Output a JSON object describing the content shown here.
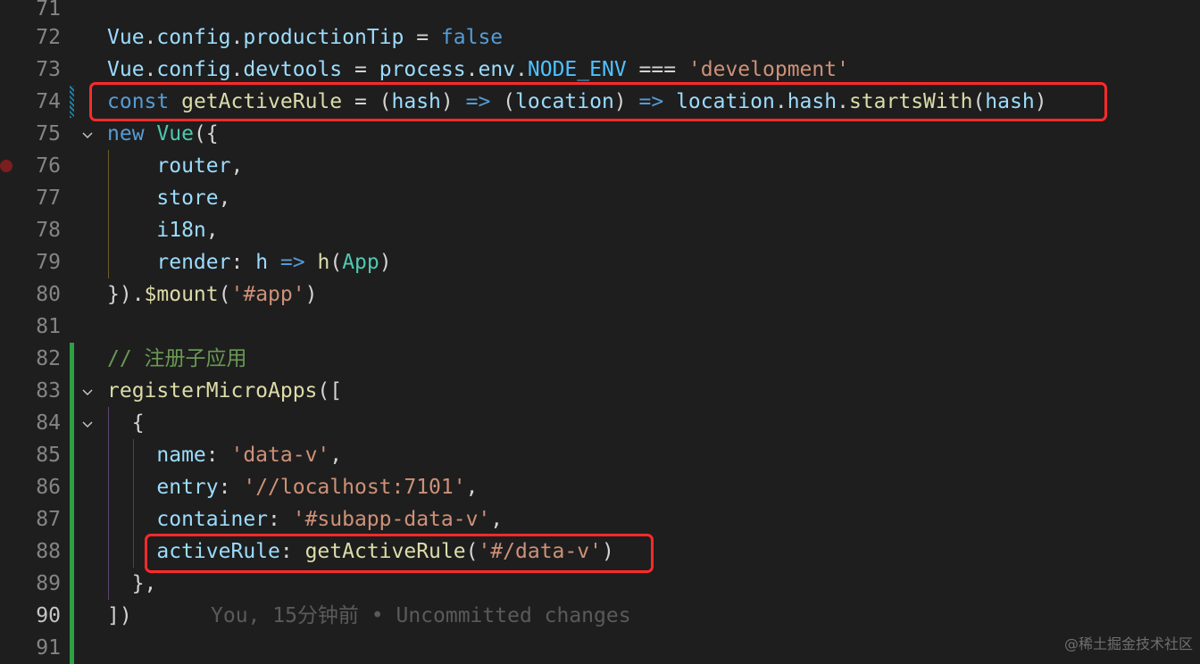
{
  "editor": {
    "lines": [
      {
        "n": "71"
      },
      {
        "n": "72",
        "tokens": [
          [
            "var",
            "Vue"
          ],
          [
            "pun",
            "."
          ],
          [
            "var",
            "config"
          ],
          [
            "pun",
            "."
          ],
          [
            "var",
            "productionTip"
          ],
          [
            "op",
            " = "
          ],
          [
            "kw",
            "false"
          ]
        ]
      },
      {
        "n": "73",
        "tokens": [
          [
            "var",
            "Vue"
          ],
          [
            "pun",
            "."
          ],
          [
            "var",
            "config"
          ],
          [
            "pun",
            "."
          ],
          [
            "var",
            "devtools"
          ],
          [
            "op",
            " = "
          ],
          [
            "var",
            "process"
          ],
          [
            "pun",
            "."
          ],
          [
            "var",
            "env"
          ],
          [
            "pun",
            "."
          ],
          [
            "const",
            "NODE_ENV"
          ],
          [
            "op",
            " === "
          ],
          [
            "str",
            "'development'"
          ]
        ]
      },
      {
        "n": "74",
        "tokens": [
          [
            "kw",
            "const "
          ],
          [
            "fn",
            "getActiveRule"
          ],
          [
            "op",
            " = "
          ],
          [
            "pun",
            "("
          ],
          [
            "var",
            "hash"
          ],
          [
            "pun",
            ") "
          ],
          [
            "kw",
            "=>"
          ],
          [
            "pun",
            " ("
          ],
          [
            "var",
            "location"
          ],
          [
            "pun",
            ") "
          ],
          [
            "kw",
            "=>"
          ],
          [
            "pun",
            " "
          ],
          [
            "var",
            "location"
          ],
          [
            "pun",
            "."
          ],
          [
            "var",
            "hash"
          ],
          [
            "pun",
            "."
          ],
          [
            "fn",
            "startsWith"
          ],
          [
            "pun",
            "("
          ],
          [
            "var",
            "hash"
          ],
          [
            "pun",
            ")"
          ]
        ]
      },
      {
        "n": "75",
        "tokens": [
          [
            "kw",
            "new "
          ],
          [
            "cls",
            "Vue"
          ],
          [
            "pun",
            "({"
          ]
        ]
      },
      {
        "n": "76",
        "tokens": [
          [
            "pun",
            "    "
          ],
          [
            "var",
            "router"
          ],
          [
            "pun",
            ","
          ]
        ]
      },
      {
        "n": "77",
        "tokens": [
          [
            "pun",
            "    "
          ],
          [
            "var",
            "store"
          ],
          [
            "pun",
            ","
          ]
        ]
      },
      {
        "n": "78",
        "tokens": [
          [
            "pun",
            "    "
          ],
          [
            "var",
            "i18n"
          ],
          [
            "pun",
            ","
          ]
        ]
      },
      {
        "n": "79",
        "tokens": [
          [
            "pun",
            "    "
          ],
          [
            "var",
            "render"
          ],
          [
            "pun",
            ": "
          ],
          [
            "var",
            "h"
          ],
          [
            "pun",
            " "
          ],
          [
            "kw",
            "=>"
          ],
          [
            "pun",
            " "
          ],
          [
            "fn",
            "h"
          ],
          [
            "pun",
            "("
          ],
          [
            "cls",
            "App"
          ],
          [
            "pun",
            ")"
          ]
        ]
      },
      {
        "n": "80",
        "tokens": [
          [
            "pun",
            "})."
          ],
          [
            "fn",
            "$mount"
          ],
          [
            "pun",
            "("
          ],
          [
            "str",
            "'#app'"
          ],
          [
            "pun",
            ")"
          ]
        ]
      },
      {
        "n": "81"
      },
      {
        "n": "82",
        "tokens": [
          [
            "cmt",
            "// 注册子应用"
          ]
        ]
      },
      {
        "n": "83",
        "tokens": [
          [
            "fn",
            "registerMicroApps"
          ],
          [
            "pun",
            "(["
          ]
        ]
      },
      {
        "n": "84",
        "tokens": [
          [
            "pun",
            "  {"
          ]
        ]
      },
      {
        "n": "85",
        "tokens": [
          [
            "pun",
            "    "
          ],
          [
            "var",
            "name"
          ],
          [
            "pun",
            ": "
          ],
          [
            "str",
            "'data-v'"
          ],
          [
            "pun",
            ","
          ]
        ]
      },
      {
        "n": "86",
        "tokens": [
          [
            "pun",
            "    "
          ],
          [
            "var",
            "entry"
          ],
          [
            "pun",
            ": "
          ],
          [
            "str",
            "'//localhost:7101'"
          ],
          [
            "pun",
            ","
          ]
        ]
      },
      {
        "n": "87",
        "tokens": [
          [
            "pun",
            "    "
          ],
          [
            "var",
            "container"
          ],
          [
            "pun",
            ": "
          ],
          [
            "str",
            "'#subapp-data-v'"
          ],
          [
            "pun",
            ","
          ]
        ]
      },
      {
        "n": "88",
        "tokens": [
          [
            "pun",
            "    "
          ],
          [
            "var",
            "activeRule"
          ],
          [
            "pun",
            ": "
          ],
          [
            "fn",
            "getActiveRule"
          ],
          [
            "pun",
            "("
          ],
          [
            "str",
            "'#/data-v'"
          ],
          [
            "pun",
            ")"
          ]
        ]
      },
      {
        "n": "89",
        "tokens": [
          [
            "pun",
            "  },"
          ]
        ]
      },
      {
        "n": "90",
        "tokens": [
          [
            "pun",
            "])"
          ]
        ]
      },
      {
        "n": "91"
      }
    ],
    "blame_text": "You, 15分钟前 • Uncommitted changes",
    "active_line": "90"
  },
  "watermark": "@稀土掘金技术社区",
  "colors": {
    "background": "#1e1e1e",
    "highlight": "#ff2a2a",
    "added": "#2ea043",
    "modified": "#1b81a8"
  }
}
